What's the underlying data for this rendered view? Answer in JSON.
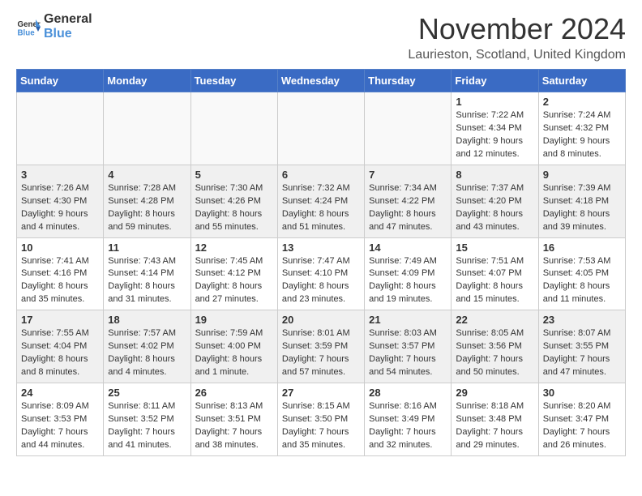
{
  "header": {
    "logo_general": "General",
    "logo_blue": "Blue",
    "title": "November 2024",
    "location": "Laurieston, Scotland, United Kingdom"
  },
  "days_of_week": [
    "Sunday",
    "Monday",
    "Tuesday",
    "Wednesday",
    "Thursday",
    "Friday",
    "Saturday"
  ],
  "weeks": [
    [
      {
        "day": "",
        "info": "",
        "empty": true
      },
      {
        "day": "",
        "info": "",
        "empty": true
      },
      {
        "day": "",
        "info": "",
        "empty": true
      },
      {
        "day": "",
        "info": "",
        "empty": true
      },
      {
        "day": "",
        "info": "",
        "empty": true
      },
      {
        "day": "1",
        "info": "Sunrise: 7:22 AM\nSunset: 4:34 PM\nDaylight: 9 hours and 12 minutes.",
        "empty": false
      },
      {
        "day": "2",
        "info": "Sunrise: 7:24 AM\nSunset: 4:32 PM\nDaylight: 9 hours and 8 minutes.",
        "empty": false
      }
    ],
    [
      {
        "day": "3",
        "info": "Sunrise: 7:26 AM\nSunset: 4:30 PM\nDaylight: 9 hours and 4 minutes.",
        "empty": false
      },
      {
        "day": "4",
        "info": "Sunrise: 7:28 AM\nSunset: 4:28 PM\nDaylight: 8 hours and 59 minutes.",
        "empty": false
      },
      {
        "day": "5",
        "info": "Sunrise: 7:30 AM\nSunset: 4:26 PM\nDaylight: 8 hours and 55 minutes.",
        "empty": false
      },
      {
        "day": "6",
        "info": "Sunrise: 7:32 AM\nSunset: 4:24 PM\nDaylight: 8 hours and 51 minutes.",
        "empty": false
      },
      {
        "day": "7",
        "info": "Sunrise: 7:34 AM\nSunset: 4:22 PM\nDaylight: 8 hours and 47 minutes.",
        "empty": false
      },
      {
        "day": "8",
        "info": "Sunrise: 7:37 AM\nSunset: 4:20 PM\nDaylight: 8 hours and 43 minutes.",
        "empty": false
      },
      {
        "day": "9",
        "info": "Sunrise: 7:39 AM\nSunset: 4:18 PM\nDaylight: 8 hours and 39 minutes.",
        "empty": false
      }
    ],
    [
      {
        "day": "10",
        "info": "Sunrise: 7:41 AM\nSunset: 4:16 PM\nDaylight: 8 hours and 35 minutes.",
        "empty": false
      },
      {
        "day": "11",
        "info": "Sunrise: 7:43 AM\nSunset: 4:14 PM\nDaylight: 8 hours and 31 minutes.",
        "empty": false
      },
      {
        "day": "12",
        "info": "Sunrise: 7:45 AM\nSunset: 4:12 PM\nDaylight: 8 hours and 27 minutes.",
        "empty": false
      },
      {
        "day": "13",
        "info": "Sunrise: 7:47 AM\nSunset: 4:10 PM\nDaylight: 8 hours and 23 minutes.",
        "empty": false
      },
      {
        "day": "14",
        "info": "Sunrise: 7:49 AM\nSunset: 4:09 PM\nDaylight: 8 hours and 19 minutes.",
        "empty": false
      },
      {
        "day": "15",
        "info": "Sunrise: 7:51 AM\nSunset: 4:07 PM\nDaylight: 8 hours and 15 minutes.",
        "empty": false
      },
      {
        "day": "16",
        "info": "Sunrise: 7:53 AM\nSunset: 4:05 PM\nDaylight: 8 hours and 11 minutes.",
        "empty": false
      }
    ],
    [
      {
        "day": "17",
        "info": "Sunrise: 7:55 AM\nSunset: 4:04 PM\nDaylight: 8 hours and 8 minutes.",
        "empty": false
      },
      {
        "day": "18",
        "info": "Sunrise: 7:57 AM\nSunset: 4:02 PM\nDaylight: 8 hours and 4 minutes.",
        "empty": false
      },
      {
        "day": "19",
        "info": "Sunrise: 7:59 AM\nSunset: 4:00 PM\nDaylight: 8 hours and 1 minute.",
        "empty": false
      },
      {
        "day": "20",
        "info": "Sunrise: 8:01 AM\nSunset: 3:59 PM\nDaylight: 7 hours and 57 minutes.",
        "empty": false
      },
      {
        "day": "21",
        "info": "Sunrise: 8:03 AM\nSunset: 3:57 PM\nDaylight: 7 hours and 54 minutes.",
        "empty": false
      },
      {
        "day": "22",
        "info": "Sunrise: 8:05 AM\nSunset: 3:56 PM\nDaylight: 7 hours and 50 minutes.",
        "empty": false
      },
      {
        "day": "23",
        "info": "Sunrise: 8:07 AM\nSunset: 3:55 PM\nDaylight: 7 hours and 47 minutes.",
        "empty": false
      }
    ],
    [
      {
        "day": "24",
        "info": "Sunrise: 8:09 AM\nSunset: 3:53 PM\nDaylight: 7 hours and 44 minutes.",
        "empty": false
      },
      {
        "day": "25",
        "info": "Sunrise: 8:11 AM\nSunset: 3:52 PM\nDaylight: 7 hours and 41 minutes.",
        "empty": false
      },
      {
        "day": "26",
        "info": "Sunrise: 8:13 AM\nSunset: 3:51 PM\nDaylight: 7 hours and 38 minutes.",
        "empty": false
      },
      {
        "day": "27",
        "info": "Sunrise: 8:15 AM\nSunset: 3:50 PM\nDaylight: 7 hours and 35 minutes.",
        "empty": false
      },
      {
        "day": "28",
        "info": "Sunrise: 8:16 AM\nSunset: 3:49 PM\nDaylight: 7 hours and 32 minutes.",
        "empty": false
      },
      {
        "day": "29",
        "info": "Sunrise: 8:18 AM\nSunset: 3:48 PM\nDaylight: 7 hours and 29 minutes.",
        "empty": false
      },
      {
        "day": "30",
        "info": "Sunrise: 8:20 AM\nSunset: 3:47 PM\nDaylight: 7 hours and 26 minutes.",
        "empty": false
      }
    ]
  ]
}
